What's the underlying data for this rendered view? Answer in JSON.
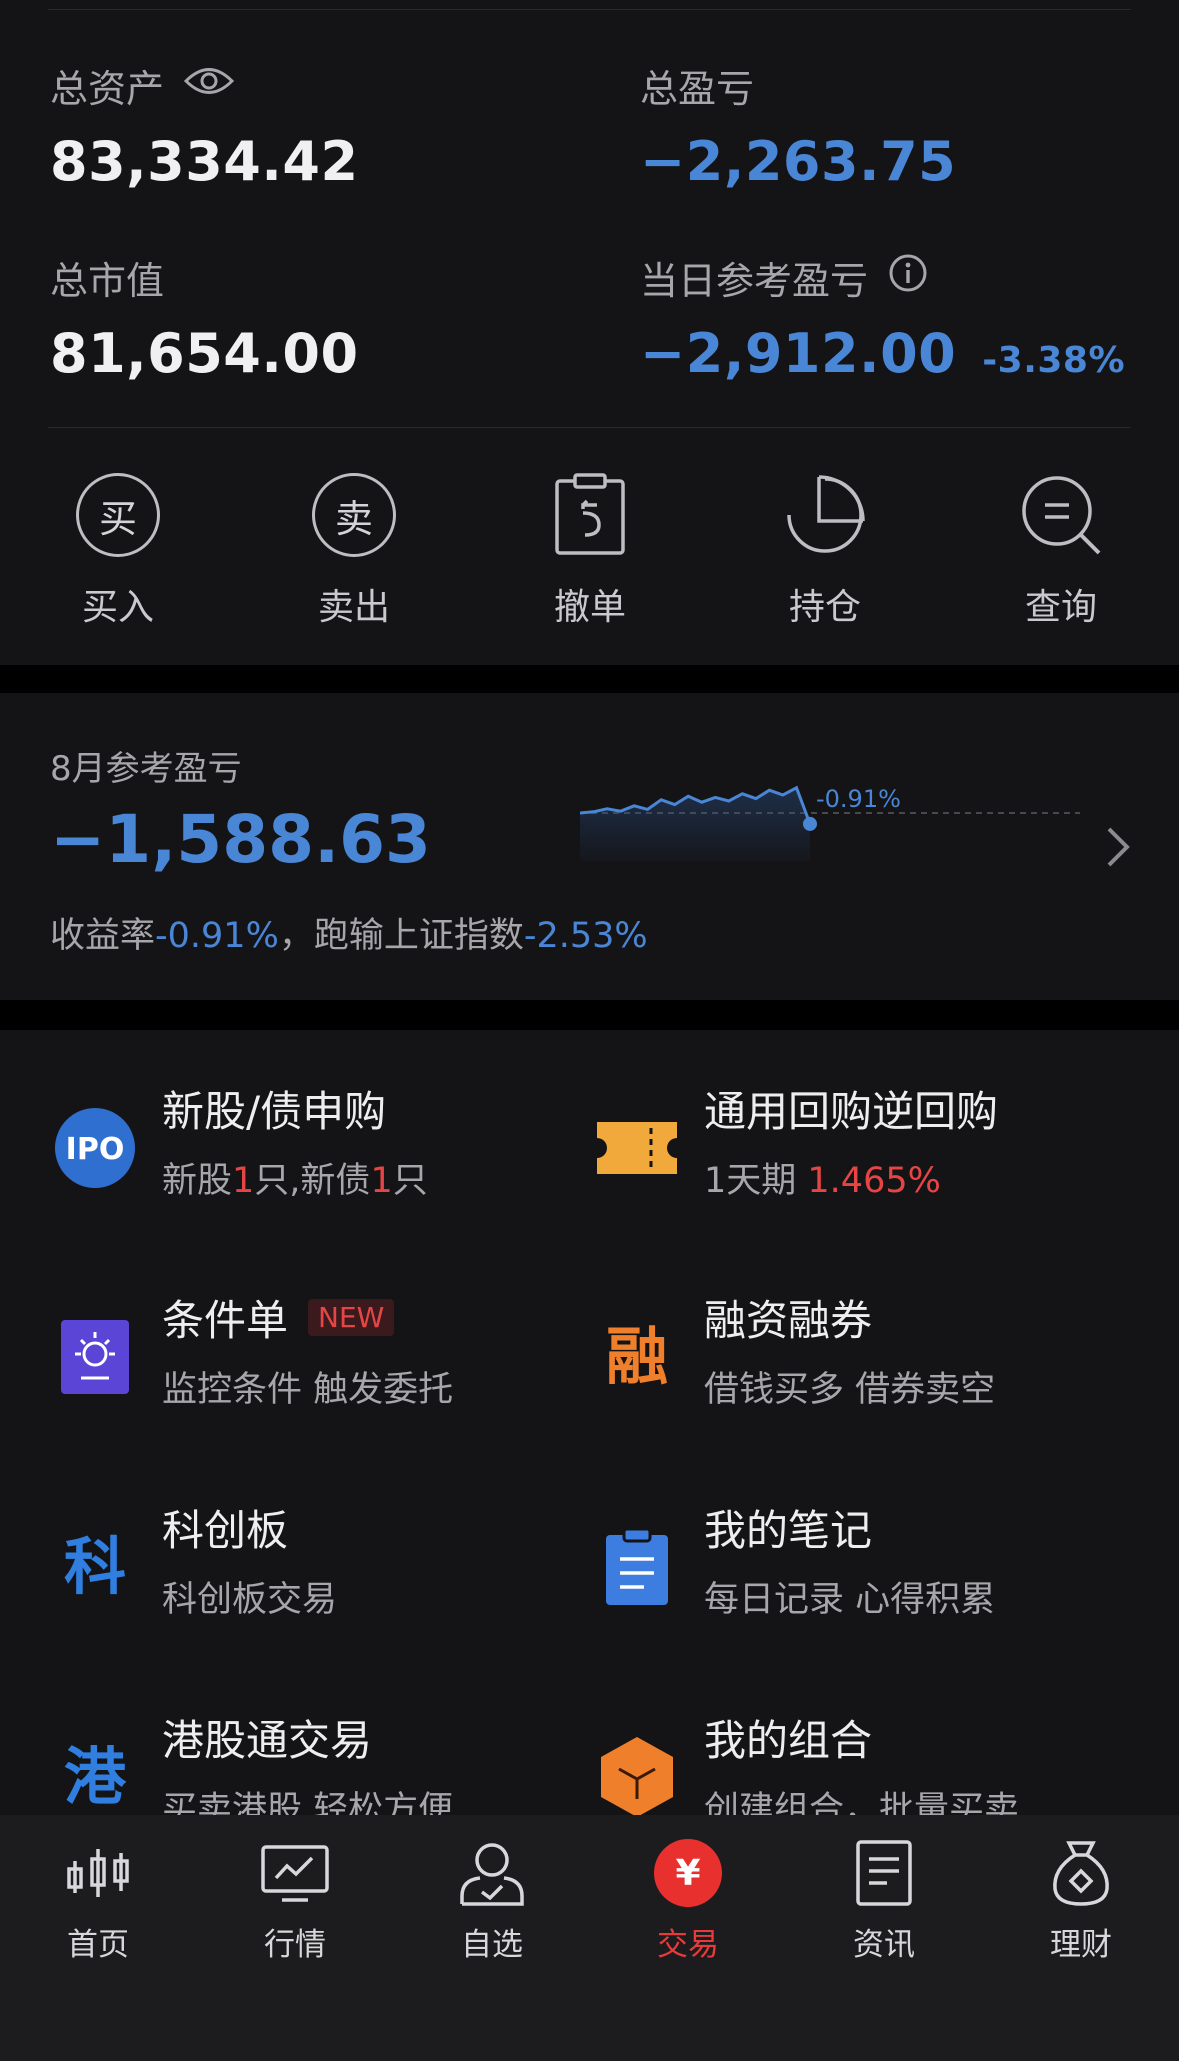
{
  "summary": {
    "total_assets": {
      "label": "总资产",
      "value": "83,334.42"
    },
    "total_pnl": {
      "label": "总盈亏",
      "value": "−2,263.75"
    },
    "market_value": {
      "label": "总市值",
      "value": "81,654.00"
    },
    "daily_pnl": {
      "label": "当日参考盈亏",
      "value": "−2,912.00",
      "pct": "-3.38%"
    }
  },
  "actions": [
    {
      "icon_char": "买",
      "label": "买入"
    },
    {
      "icon_char": "卖",
      "label": "卖出"
    },
    {
      "label": "撤单"
    },
    {
      "label": "持仓"
    },
    {
      "label": "查询"
    }
  ],
  "monthly": {
    "label": "8月参考盈亏",
    "value": "−1,588.63",
    "return_label": "收益率",
    "return_value": "-0.91%",
    "separator": "，",
    "benchmark_label": "跑输上证指数",
    "benchmark_value": "-2.53%",
    "spark_label": "-0.91%",
    "spark_values": [
      0.0,
      0.1,
      0.35,
      0.15,
      0.6,
      0.3,
      1.1,
      0.7,
      1.4,
      0.9,
      1.3,
      1.0,
      1.6,
      1.2,
      1.9,
      1.5,
      2.1,
      -0.91
    ]
  },
  "features": [
    {
      "title": "新股/债申购",
      "desc_a": "新股",
      "desc_num1": "1",
      "desc_b": "只,新债",
      "desc_num2": "1",
      "desc_c": "只",
      "icon_text": "IPO"
    },
    {
      "title": "通用回购逆回购",
      "desc_a": "1天期 ",
      "desc_rate": "1.465%"
    },
    {
      "title": "条件单",
      "badge": "NEW",
      "desc": "监控条件 触发委托"
    },
    {
      "title": "融资融券",
      "desc": "借钱买多 借券卖空",
      "icon_text": "融"
    },
    {
      "title": "科创板",
      "desc": "科创板交易",
      "icon_text": "科"
    },
    {
      "title": "我的笔记",
      "desc": "每日记录 心得积累"
    },
    {
      "title": "港股通交易",
      "desc": "买卖港股 轻松方便",
      "icon_text": "港"
    },
    {
      "title": "我的组合",
      "desc": "创建组合，批量买卖"
    }
  ],
  "tabs": [
    {
      "label": "首页"
    },
    {
      "label": "行情"
    },
    {
      "label": "自选"
    },
    {
      "label": "交易",
      "icon_text": "¥"
    },
    {
      "label": "资讯"
    },
    {
      "label": "理财"
    }
  ],
  "colors": {
    "accent_blue": "#4a86d6",
    "accent_red": "#e64545",
    "card_bg": "#141416"
  }
}
